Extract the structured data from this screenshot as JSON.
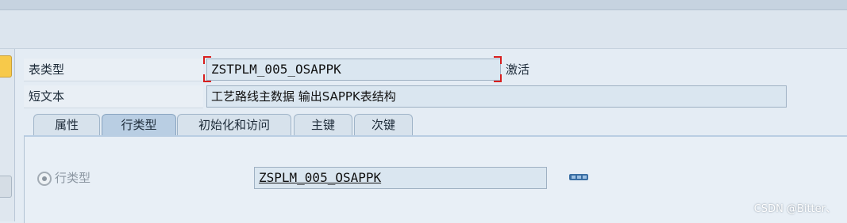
{
  "header": {
    "table_type_label": "表类型",
    "table_type_value": "ZSTPLM_005_OSAPPK",
    "status": "激活",
    "short_text_label": "短文本",
    "short_text_value": "工艺路线主数据 输出SAPPK表结构"
  },
  "tabs": [
    {
      "label": "属性",
      "active": false
    },
    {
      "label": "行类型",
      "active": true
    },
    {
      "label": "初始化和访问",
      "active": false
    },
    {
      "label": "主键",
      "active": false
    },
    {
      "label": "次键",
      "active": false
    }
  ],
  "row_type": {
    "radio_label": "行类型",
    "value": "ZSPLM_005_OSAPPK",
    "selected": true
  },
  "watermark": "CSDN @Bitter、"
}
